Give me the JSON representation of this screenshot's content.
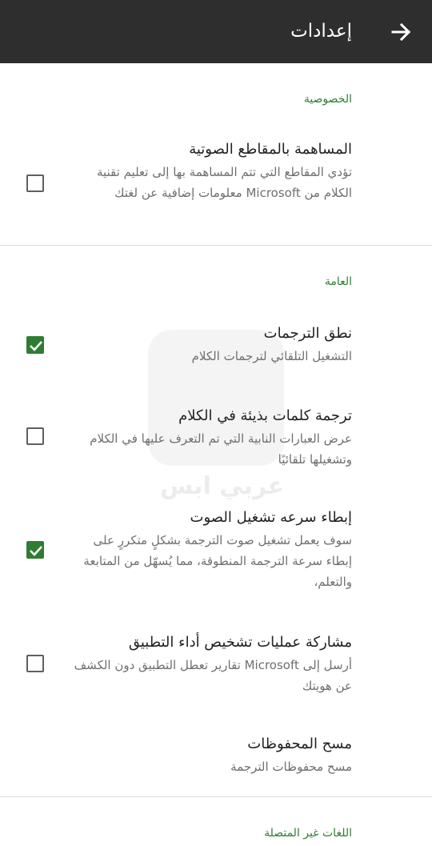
{
  "appbar": {
    "title": "إعدادات",
    "back_icon": "arrow-right-icon"
  },
  "sections": {
    "privacy": {
      "header": "الخصوصية"
    },
    "general": {
      "header": "العامة"
    },
    "offline": {
      "header": "اللغات غير المتصلة"
    }
  },
  "items": {
    "voice_clips": {
      "title": "المساهمة بالمقاطع الصوتية",
      "desc": "تؤدي المقاطع التي تتم المساهمة بها إلى تعليم تقنية الكلام من Microsoft معلومات إضافية عن لغتك",
      "checked": false
    },
    "speak_translations": {
      "title": "نطق الترجمات",
      "desc": "التشغيل التلقائي لترجمات الكلام",
      "checked": true
    },
    "profanity": {
      "title": "ترجمة كلمات بذيئة في الكلام",
      "desc": "عرض العبارات النابية التي تم التعرف عليها في الكلام وتشغيلها تلقائيًا",
      "checked": false
    },
    "slow_playback": {
      "title": "إبطاء سرعه تشغيل الصوت",
      "desc": "سوف يعمل تشغيل صوت الترجمة بشكلٍ متكررٍ على إبطاء سرعة الترجمة المنطوقة، مما يُسهّل من المتابعة والتعلم،",
      "checked": true
    },
    "diagnostics": {
      "title": "مشاركة عمليات تشخيص أداء التطبيق",
      "desc": "أرسل إلى Microsoft تقارير تعطل التطبيق دون الكشف عن هويتك",
      "checked": false
    },
    "clear_saved": {
      "title": "مسح المحفوظات",
      "desc": "مسح محفوظات الترجمة"
    }
  },
  "watermark": {
    "text": "عربي ابس"
  },
  "colors": {
    "appbar": "#2e2e2e",
    "accent": "#2e7d32"
  }
}
